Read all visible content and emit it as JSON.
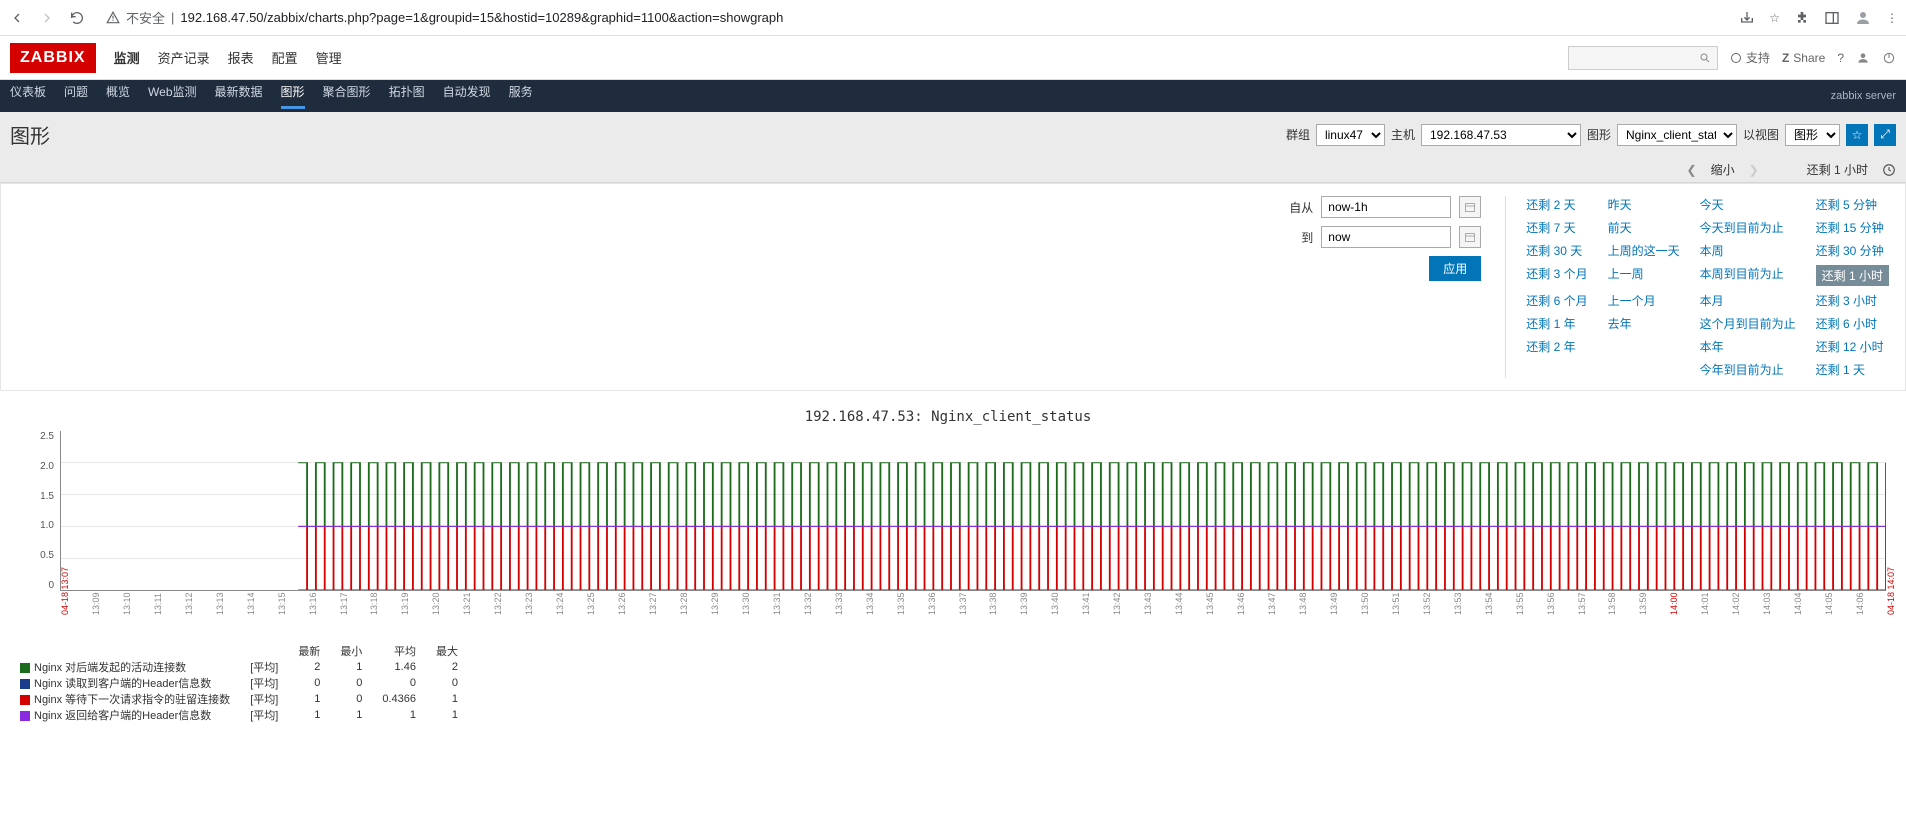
{
  "browser": {
    "url_prefix": "不安全",
    "url": "192.168.47.50/zabbix/charts.php?page=1&groupid=15&hostid=10289&graphid=1100&action=showgraph"
  },
  "top_menu": {
    "logo": "ZABBIX",
    "items": [
      "监测",
      "资产记录",
      "报表",
      "配置",
      "管理"
    ],
    "active": 0,
    "support": "支持",
    "share": "Share"
  },
  "sub_menu": {
    "items": [
      "仪表板",
      "问题",
      "概览",
      "Web监测",
      "最新数据",
      "图形",
      "聚合图形",
      "拓扑图",
      "自动发现",
      "服务"
    ],
    "active": 5,
    "server": "zabbix server"
  },
  "page": {
    "title": "图形",
    "group_label": "群组",
    "group_value": "linux47",
    "host_label": "主机",
    "host_value": "192.168.47.53",
    "graph_label": "图形",
    "graph_value": "Nginx_client_status",
    "view_label": "以视图",
    "view_value": "图形"
  },
  "time_nav": {
    "zoom_out": "缩小",
    "current": "还剩 1 小时"
  },
  "time_filter": {
    "from_label": "自从",
    "from_value": "now-1h",
    "to_label": "到",
    "to_value": "now",
    "apply": "应用",
    "presets": [
      [
        "还剩 2 天",
        "昨天",
        "今天",
        "还剩 5 分钟"
      ],
      [
        "还剩 7 天",
        "前天",
        "今天到目前为止",
        "还剩 15 分钟"
      ],
      [
        "还剩 30 天",
        "上周的这一天",
        "本周",
        "还剩 30 分钟"
      ],
      [
        "还剩 3 个月",
        "上一周",
        "本周到目前为止",
        "还剩 1 小时"
      ],
      [
        "还剩 6 个月",
        "上一个月",
        "本月",
        "还剩 3 小时"
      ],
      [
        "还剩 1 年",
        "去年",
        "这个月到目前为止",
        "还剩 6 小时"
      ],
      [
        "还剩 2 年",
        "",
        "本年",
        "还剩 12 小时"
      ],
      [
        "",
        "",
        "今年到目前为止",
        "还剩 1 天"
      ]
    ],
    "selected": "还剩 1 小时"
  },
  "chart_data": {
    "type": "line",
    "title": "192.168.47.53: Nginx_client_status",
    "ylim": [
      0,
      2.5
    ],
    "yticks": [
      "2.5",
      "2.0",
      "1.5",
      "1.0",
      "0.5",
      "0"
    ],
    "x_start": "04-18 13:07",
    "x_end": "04-18 14:07",
    "xticks": [
      "13:09",
      "13:10",
      "13:11",
      "13:12",
      "13:13",
      "13:14",
      "13:15",
      "13:16",
      "13:17",
      "13:18",
      "13:19",
      "13:20",
      "13:21",
      "13:22",
      "13:23",
      "13:24",
      "13:25",
      "13:26",
      "13:27",
      "13:28",
      "13:29",
      "13:30",
      "13:31",
      "13:32",
      "13:33",
      "13:34",
      "13:35",
      "13:36",
      "13:37",
      "13:38",
      "13:39",
      "13:40",
      "13:41",
      "13:42",
      "13:43",
      "13:44",
      "13:45",
      "13:46",
      "13:47",
      "13:48",
      "13:49",
      "13:50",
      "13:51",
      "13:52",
      "13:53",
      "13:54",
      "13:55",
      "13:56",
      "13:57",
      "13:58",
      "13:59",
      "14:00",
      "14:01",
      "14:02",
      "14:03",
      "14:04",
      "14:05",
      "14:06"
    ],
    "xtick_red": "14:00",
    "series": [
      {
        "name": "Nginx 对后端发起的活动连接数",
        "color": "#1a6b1a",
        "agg": "[平均]",
        "last": 2,
        "min": 1,
        "avg": 1.46,
        "max": 2
      },
      {
        "name": "Nginx 读取到客户端的Header信息数",
        "color": "#1a3c8c",
        "agg": "[平均]",
        "last": 0,
        "min": 0,
        "avg": 0,
        "max": 0
      },
      {
        "name": "Nginx 等待下一次请求指令的驻留连接数",
        "color": "#d40000",
        "agg": "[平均]",
        "last": 1,
        "min": 0,
        "avg": 0.4366,
        "max": 1
      },
      {
        "name": "Nginx 返回给客户端的Header信息数",
        "color": "#8a2be2",
        "agg": "[平均]",
        "last": 1,
        "min": 1,
        "avg": 1,
        "max": 1
      }
    ],
    "legend_headers": [
      "最新",
      "最小",
      "平均",
      "最大"
    ]
  }
}
